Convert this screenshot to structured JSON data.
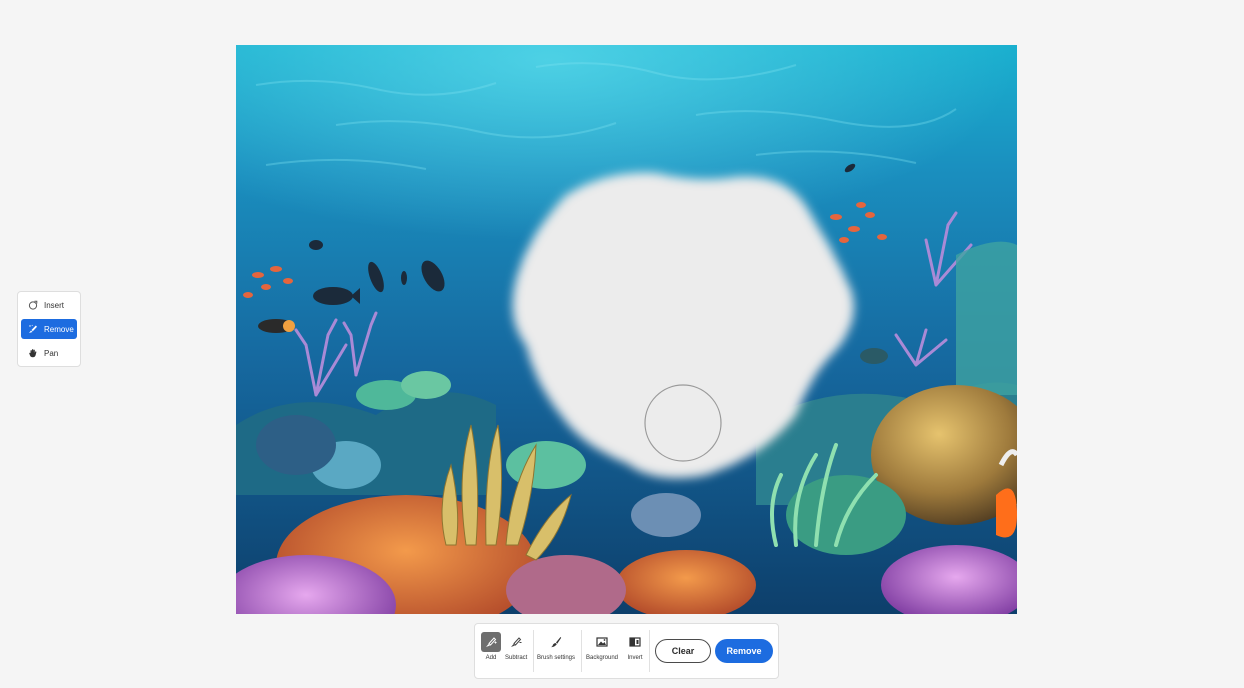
{
  "tools": [
    {
      "label": "Insert",
      "icon": "insert-icon",
      "active": false
    },
    {
      "label": "Remove",
      "icon": "remove-brush-icon",
      "active": true
    },
    {
      "label": "Pan",
      "icon": "hand-icon",
      "active": false
    }
  ],
  "canvas": {
    "image_subject": "underwater coral reef",
    "masked_region": "transparent checkerboard"
  },
  "toolbar": {
    "add_label": "Add",
    "subtract_label": "Subtract",
    "brush_settings_label": "Brush settings",
    "background_label": "Background",
    "invert_label": "Invert",
    "clear_label": "Clear",
    "remove_label": "Remove"
  },
  "colors": {
    "accent": "#1d6ce0",
    "selected_tool": "#6e6e6e"
  }
}
